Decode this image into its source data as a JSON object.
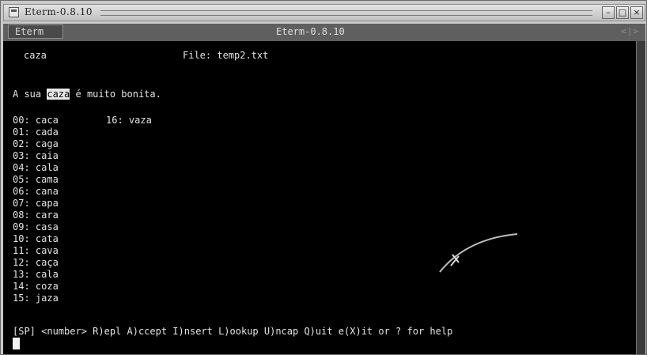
{
  "window": {
    "title": "Eterm-0.8.10"
  },
  "tabbar": {
    "tab_label": "Eterm",
    "title": "Eterm-0.8.10"
  },
  "terminal": {
    "word": "caza",
    "file_label": "File: temp2.txt",
    "sentence_before": "A sua ",
    "highlight_word": "caza",
    "sentence_after": " é muito bonita.",
    "suggestions": [
      "00: caca",
      "01: cada",
      "02: caga",
      "03: caia",
      "04: cala",
      "05: cama",
      "06: cana",
      "07: capa",
      "08: cara",
      "09: casa",
      "10: cata",
      "11: cava",
      "12: caça",
      "13: cala",
      "14: coza",
      "15: jaza"
    ],
    "suggestion_col2": "16: vaza",
    "help_line": "[SP] <number> R)epl A)ccept I)nsert L)ookup U)ncap Q)uit e(X)it or ? for help"
  }
}
